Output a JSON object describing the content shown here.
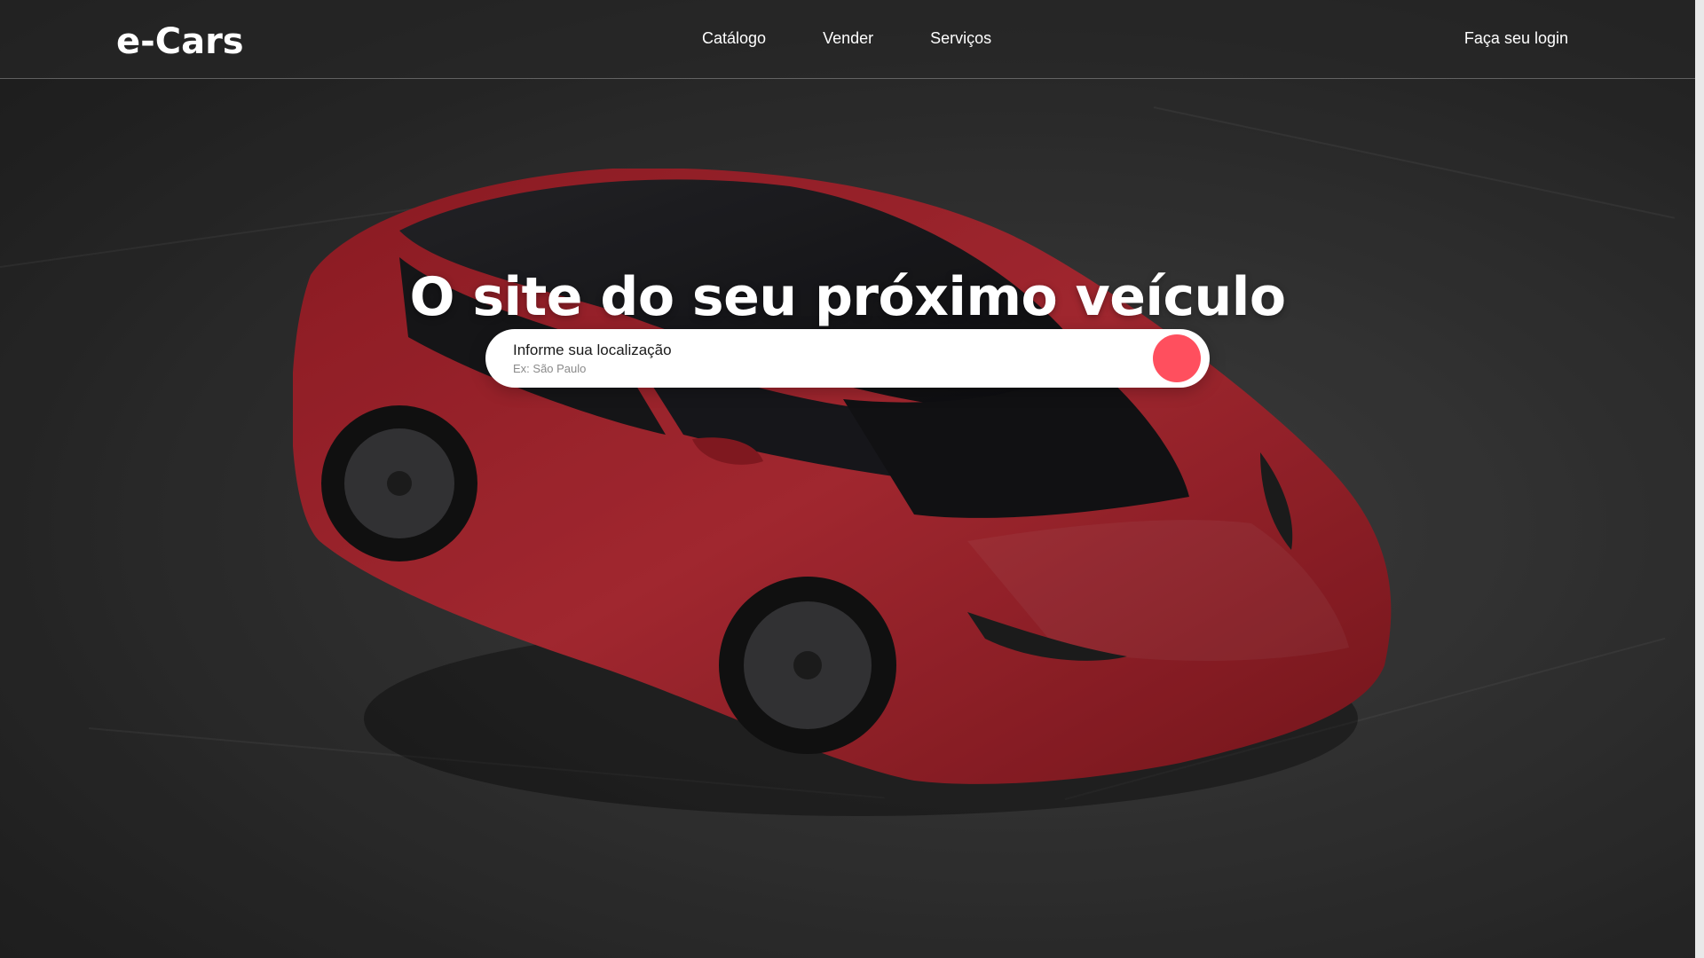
{
  "navbar": {
    "logo": "e-Cars",
    "links": [
      {
        "label": "Catálogo"
      },
      {
        "label": "Vender"
      },
      {
        "label": "Serviços"
      }
    ],
    "login": "Faça seu login"
  },
  "hero": {
    "headline": "O site do seu próximo veículo",
    "search": {
      "label": "Informe sua localização",
      "placeholder": "Ex: São Paulo",
      "button_color": "#ff4f5e"
    }
  }
}
